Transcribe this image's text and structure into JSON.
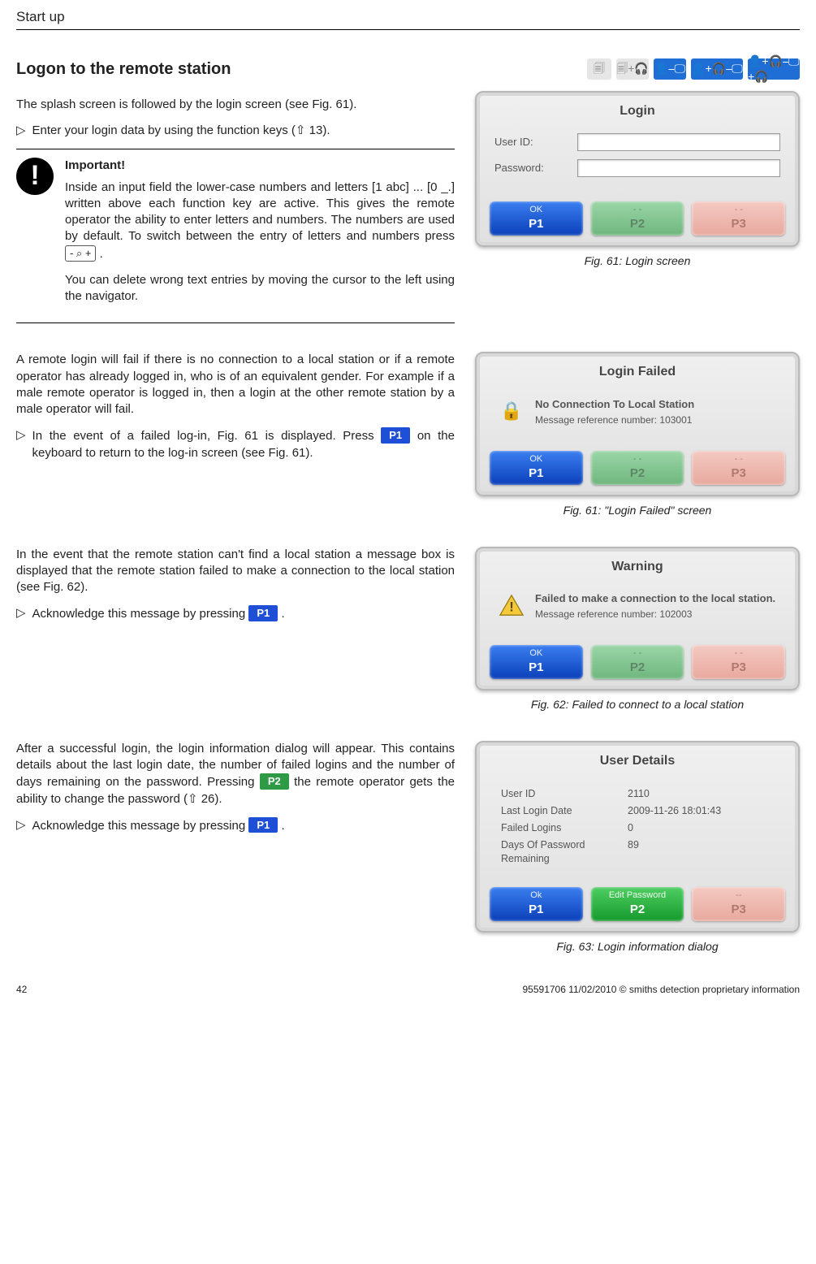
{
  "header": {
    "title": "Start up"
  },
  "section_title": "Logon to the remote station",
  "intro": "The splash screen is followed by the login screen (see Fig. 61).",
  "step1": {
    "tri": "▷",
    "text": "Enter your login data by using the function keys (⇧ 13)."
  },
  "important": {
    "label": "Important!",
    "para1a": "Inside an input field the lower-case numbers and letters [1 abc] ... [0 _.] written above each function key are active. This gives the remote operator the ability to enter letters and numbers. The numbers are used by default. To switch between the entry of letters and numbers press ",
    "key": "- ⌕ +",
    "para1b": " .",
    "para2": "You can delete wrong text entries by moving the cursor to the left using the navigator."
  },
  "fig61": {
    "title": "Login",
    "user_lbl": "User ID:",
    "pass_lbl": "Password:",
    "p1_top": "OK",
    "p1_bot": "P1",
    "p2_top": "- -",
    "p2_bot": "P2",
    "p3_top": "- -",
    "p3_bot": "P3",
    "caption": "Fig. 61: Login screen"
  },
  "block2": {
    "para": "A remote login will fail if there is no connection to a local station or if a remote operator has already logged in, who is of an equivalent gender. For example if a male remote operator is logged in, then a login at the other remote station by a male operator will fail.",
    "step_tri": "▷",
    "step_a": "In the event of a failed log-in, Fig. 61 is displayed. Press ",
    "step_key": "P1",
    "step_b": " on the keyboard to return to the log-in screen (see Fig. 61)."
  },
  "fig61b": {
    "title": "Login Failed",
    "msg_title": "No Connection To Local Station",
    "msg_ref": "Message reference number: 103001",
    "p1_top": "OK",
    "p1_bot": "P1",
    "p2_top": "- -",
    "p2_bot": "P2",
    "p3_top": "- -",
    "p3_bot": "P3",
    "caption": "Fig. 61: \"Login Failed\" screen"
  },
  "block3": {
    "para": "In the event that the remote station can't find a local station a message box is displayed that the remote station failed to make a connection to the local station (see Fig. 62).",
    "step_tri": "▷",
    "step_a": "Acknowledge this message by pressing ",
    "step_key": "P1",
    "step_b": "."
  },
  "fig62": {
    "title": "Warning",
    "msg_title": "Failed to make a connection to the local station.",
    "msg_ref": "Message reference number: 102003",
    "p1_top": "OK",
    "p1_bot": "P1",
    "p2_top": "- -",
    "p2_bot": "P2",
    "p3_top": "- -",
    "p3_bot": "P3",
    "caption": "Fig. 62: Failed to connect to a local station"
  },
  "block4": {
    "para_a": "After a successful login, the login information dialog will appear. This contains details about the last login date, the number of failed logins and the number of days remaining on the password. Pressing ",
    "p2_key": "P2",
    "para_b": " the remote operator gets the ability to change the password (⇧ 26).",
    "step_tri": "▷",
    "step_a": "Acknowledge this message by pressing ",
    "step_key": "P1",
    "step_b": "."
  },
  "fig63": {
    "title": "User Details",
    "rows": [
      {
        "label": "User ID",
        "value": "2110"
      },
      {
        "label": "Last Login Date",
        "value": "2009-11-26 18:01:43"
      },
      {
        "label": "Failed Logins",
        "value": "0"
      },
      {
        "label": "Days Of Password Remaining",
        "value": "89"
      }
    ],
    "p1_top": "Ok",
    "p1_bot": "P1",
    "p2_top": "Edit Password",
    "p2_bot": "P2",
    "p3_top": "--",
    "p3_bot": "P3",
    "caption": "Fig. 63: Login information dialog"
  },
  "footer": {
    "page": "42",
    "right": "95591706 11/02/2010 © smiths detection proprietary information"
  }
}
